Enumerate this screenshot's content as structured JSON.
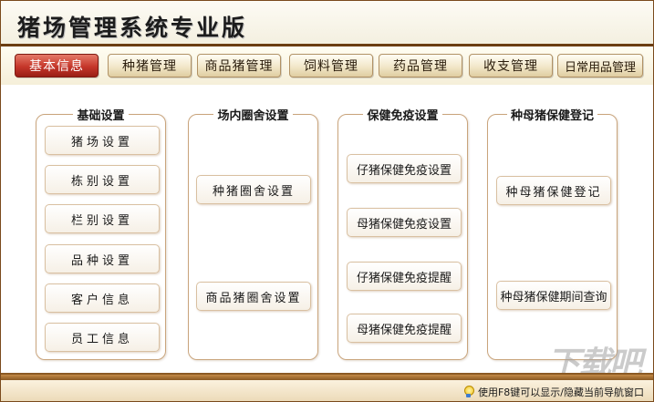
{
  "header": {
    "title": "猪场管理系统专业版"
  },
  "nav": {
    "tabs": [
      {
        "label": "基本信息",
        "active": true
      },
      {
        "label": "种猪管理",
        "active": false
      },
      {
        "label": "商品猪管理",
        "active": false
      },
      {
        "label": "饲料管理",
        "active": false
      },
      {
        "label": "药品管理",
        "active": false
      },
      {
        "label": "收支管理",
        "active": false
      },
      {
        "label": "日常用品管理",
        "active": false
      }
    ]
  },
  "groups": [
    {
      "title": "基础设置",
      "buttons": [
        "猪场设置",
        "栋别设置",
        "栏别设置",
        "品种设置",
        "客户信息",
        "员工信息"
      ]
    },
    {
      "title": "场内圈舍设置",
      "buttons": [
        "种猪圈舍设置",
        "商品猪圈舍设置"
      ]
    },
    {
      "title": "保健免疫设置",
      "buttons": [
        "仔猪保健免疫设置",
        "母猪保健免疫设置",
        "仔猪保健免疫提醒",
        "母猪保健免疫提醒"
      ]
    },
    {
      "title": "种母猪保健登记",
      "buttons": [
        "种母猪保健登记",
        "种母猪保健期间查询"
      ]
    }
  ],
  "status_bar": {
    "hint": "使用F8键可以显示/隐藏当前导航窗口"
  },
  "watermark": "下载吧",
  "colors": {
    "active_tab": "#c5362a",
    "accent_brown": "#8b5a24",
    "group_border": "#c9a47c"
  }
}
